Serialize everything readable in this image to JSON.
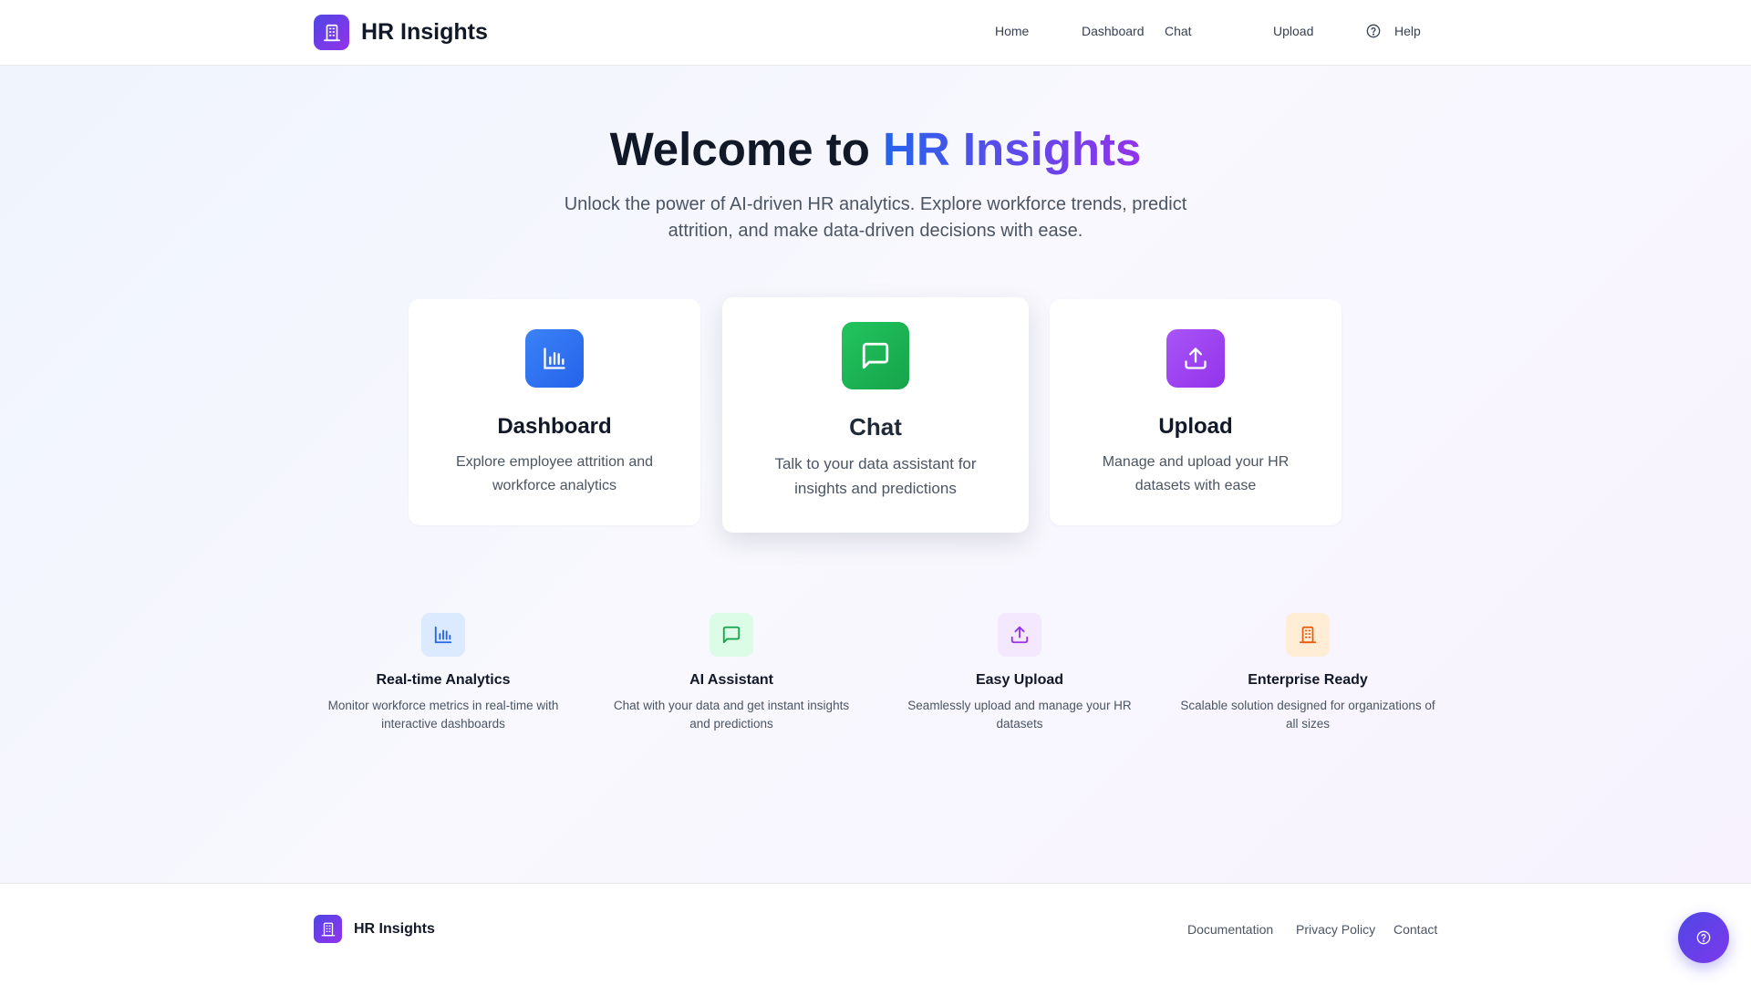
{
  "app": {
    "name": "HR Insights",
    "logo_icon": "building-icon"
  },
  "nav": {
    "items": [
      {
        "label": "Home"
      },
      {
        "label": "Dashboard"
      },
      {
        "label": "Chat"
      },
      {
        "label": "Upload"
      },
      {
        "label": "Help",
        "icon": "help-circle-icon"
      }
    ]
  },
  "hero": {
    "title_prefix": "Welcome to",
    "title_accent": "HR Insights",
    "subtitle": "Unlock the power of AI-driven HR analytics. Explore workforce trends, predict attrition, and make data-driven decisions with ease."
  },
  "cards": [
    {
      "title": "Dashboard",
      "description": "Explore employee attrition and workforce analytics",
      "icon": "bar-chart-icon",
      "color": "#2563eb"
    },
    {
      "title": "Chat",
      "description": "Talk to your data assistant for insights and predictions",
      "icon": "message-square-icon",
      "color": "#16a34a"
    },
    {
      "title": "Upload",
      "description": "Manage and upload your HR datasets with ease",
      "icon": "upload-icon",
      "color": "#9333ea"
    }
  ],
  "features": [
    {
      "title": "Real-time Analytics",
      "description": "Monitor workforce metrics in real-time with interactive dashboards",
      "icon": "bar-chart-icon",
      "color": "#2563eb"
    },
    {
      "title": "AI Assistant",
      "description": "Chat with your data and get instant insights and predictions",
      "icon": "message-square-icon",
      "color": "#16a34a"
    },
    {
      "title": "Easy Upload",
      "description": "Seamlessly upload and manage your HR datasets",
      "icon": "upload-icon",
      "color": "#9333ea"
    },
    {
      "title": "Enterprise Ready",
      "description": "Scalable solution designed for organizations of all sizes",
      "icon": "building-icon",
      "color": "#ea580c"
    }
  ],
  "footer": {
    "brand": "HR Insights",
    "links": [
      {
        "label": "Documentation"
      },
      {
        "label": "Privacy Policy"
      },
      {
        "label": "Contact"
      }
    ]
  },
  "fab": {
    "icon": "help-circle-icon"
  },
  "colors": {
    "accent_start": "#2563eb",
    "accent_end": "#9333ea",
    "brand": "#4f46e5"
  }
}
